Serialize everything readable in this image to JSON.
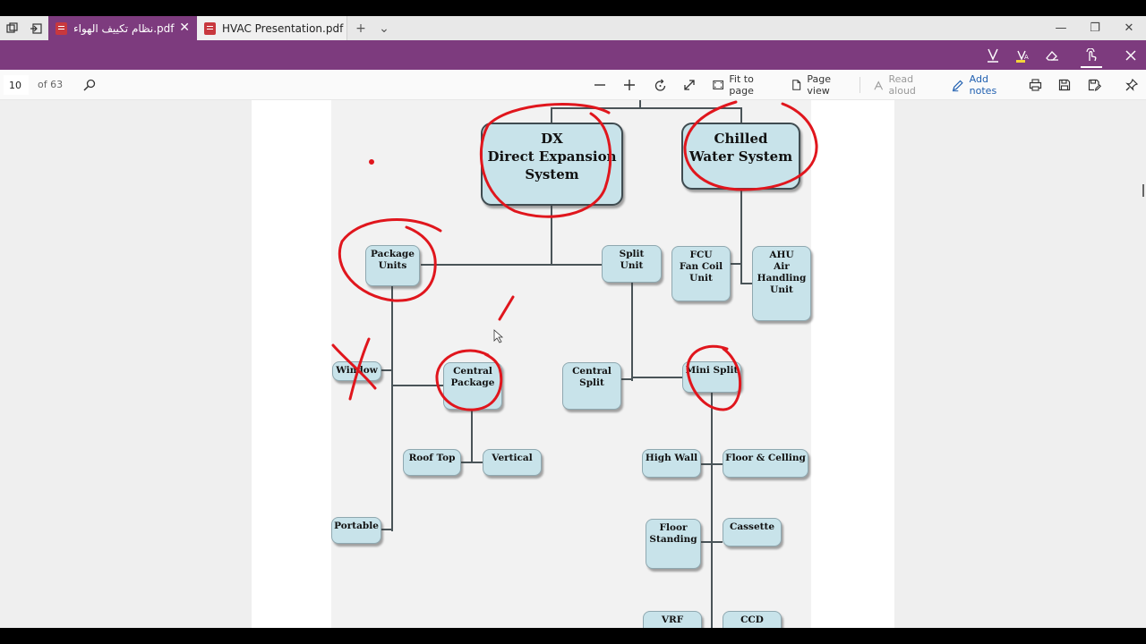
{
  "tabs": [
    {
      "title": "نظام تكييف الهواء.pdf",
      "active": true
    },
    {
      "title": "HVAC Presentation.pdf",
      "active": false
    }
  ],
  "tab_controls": {
    "new_tab": "+",
    "tab_list": "⌄"
  },
  "window_controls": {
    "minimize": "—",
    "restore": "❐",
    "close": "✕"
  },
  "reading_toolbar": {
    "page_number": "10",
    "page_total": "of 63",
    "fit_to_page_label": "Fit to page",
    "page_view_label": "Page view",
    "read_aloud_label": "Read aloud",
    "add_notes_label": "Add notes"
  },
  "diagram": {
    "nodes": {
      "dx": "DX\nDirect Expansion\nSystem",
      "chilled": "Chilled\nWater System",
      "package_units": "Package\nUnits",
      "split_unit": "Split\nUnit",
      "fcu": "FCU\nFan Coil\nUnit",
      "ahu": "AHU\nAir\nHandling\nUnit",
      "window": "Window",
      "central_package": "Central\nPackage",
      "central_split": "Central\nSplit",
      "mini_split": "Mini Split",
      "roof_top": "Roof Top",
      "vertical": "Vertical",
      "high_wall": "High Wall",
      "floor_ceiling": "Floor & Celling",
      "floor_standing": "Floor\nStanding",
      "cassette": "Cassette",
      "portable": "Portable",
      "vrf": "VRF",
      "ccd": "CCD"
    }
  },
  "colors": {
    "accent_purple": "#7d3b7e",
    "annotation_red": "#e0161d",
    "node_fill": "#c8e3ea"
  }
}
